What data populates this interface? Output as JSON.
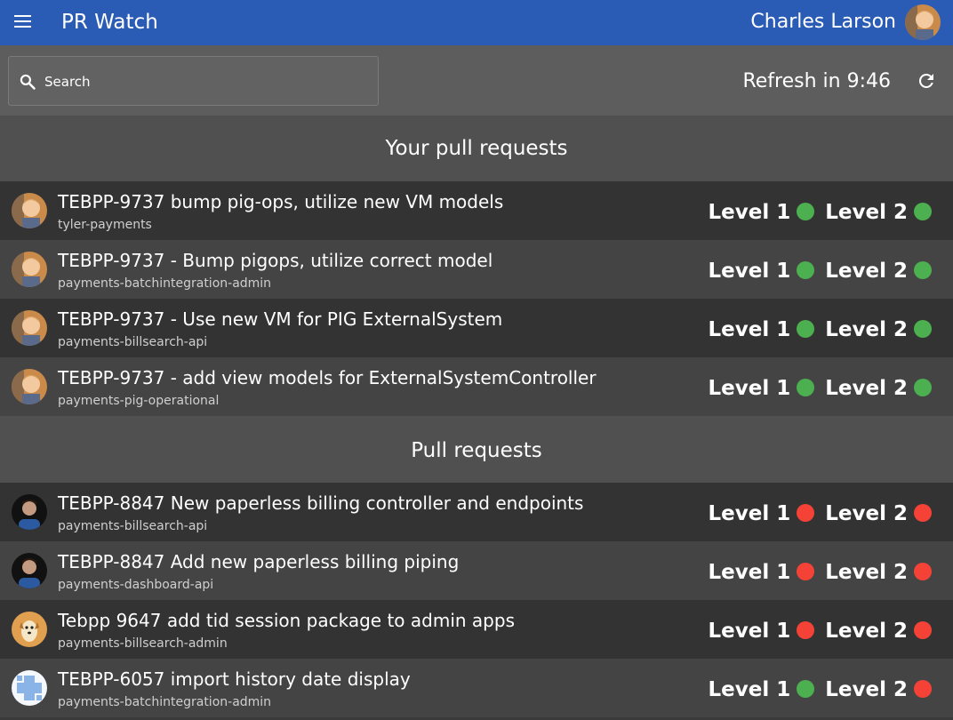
{
  "app_bar": {
    "title": "PR Watch",
    "user_name": "Charles Larson",
    "brand_color": "#2a5bb5"
  },
  "toolbar": {
    "search_placeholder": "Search",
    "search_value": "",
    "refresh_text": "Refresh in 9:46"
  },
  "sections": {
    "yours": "Your pull requests",
    "all": "Pull requests"
  },
  "your_prs": [
    {
      "title": "TEBPP-9737 bump pig-ops, utilize new VM models",
      "repo": "tyler-payments",
      "level1_label": "Level 1",
      "level2_label": "Level 2",
      "level1_status": "green",
      "level2_status": "green",
      "avatar": "cartoon-user-avatar"
    },
    {
      "title": "TEBPP-9737 - Bump pigops, utilize correct model",
      "repo": "payments-batchintegration-admin",
      "level1_label": "Level 1",
      "level2_label": "Level 2",
      "level1_status": "green",
      "level2_status": "green",
      "avatar": "cartoon-user-avatar"
    },
    {
      "title": "TEBPP-9737 - Use new VM for PIG ExternalSystem",
      "repo": "payments-billsearch-api",
      "level1_label": "Level 1",
      "level2_label": "Level 2",
      "level1_status": "green",
      "level2_status": "green",
      "avatar": "cartoon-user-avatar"
    },
    {
      "title": "TEBPP-9737 - add view models for ExternalSystemController",
      "repo": "payments-pig-operational",
      "level1_label": "Level 1",
      "level2_label": "Level 2",
      "level1_status": "green",
      "level2_status": "green",
      "avatar": "cartoon-user-avatar"
    }
  ],
  "other_prs": [
    {
      "title": "TEBPP-8847 New paperless billing controller and endpoints",
      "repo": "payments-billsearch-api",
      "level1_label": "Level 1",
      "level2_label": "Level 2",
      "level1_status": "red",
      "level2_status": "red",
      "avatar": "photo-user-avatar"
    },
    {
      "title": "TEBPP-8847 Add new paperless billing piping",
      "repo": "payments-dashboard-api",
      "level1_label": "Level 1",
      "level2_label": "Level 2",
      "level1_status": "red",
      "level2_status": "red",
      "avatar": "photo-user-avatar"
    },
    {
      "title": "Tebpp 9647 add tid session package to admin apps",
      "repo": "payments-billsearch-admin",
      "level1_label": "Level 1",
      "level2_label": "Level 2",
      "level1_status": "red",
      "level2_status": "red",
      "avatar": "dog-avatar"
    },
    {
      "title": "TEBPP-6057 import history date display",
      "repo": "payments-batchintegration-admin",
      "level1_label": "Level 1",
      "level2_label": "Level 2",
      "level1_status": "green",
      "level2_status": "red",
      "avatar": "identicon-avatar"
    }
  ],
  "status_colors": {
    "green": "#4caf50",
    "red": "#f44336"
  }
}
